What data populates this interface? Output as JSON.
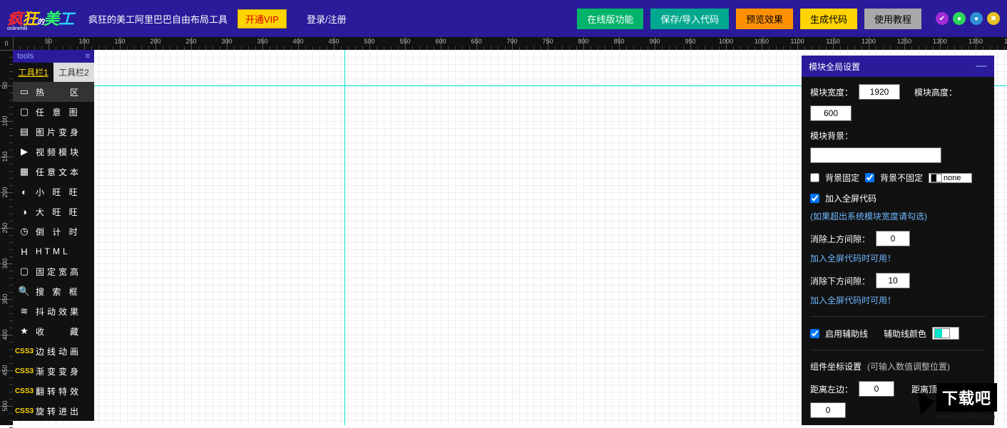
{
  "header": {
    "app_title": "疯狂的美工阿里巴巴自由布局工具",
    "vip": "开通VIP",
    "auth": "登录/注册",
    "buttons": {
      "online": "在线版功能",
      "saveload": "保存/导入代码",
      "preview": "预览效果",
      "generate": "生成代码",
      "tutorial": "使用教程"
    },
    "circles": {
      "a": "✔",
      "b": "●",
      "c": "●",
      "d": "✖"
    }
  },
  "ruler": {
    "corner": "0"
  },
  "toolbox": {
    "title": "tools",
    "handle": "≡",
    "tabs": {
      "t1": "工具栏1",
      "t2": "工具栏2"
    },
    "items": [
      {
        "icon": "▭",
        "label": "热　　区"
      },
      {
        "icon": "▢",
        "label": "任 意 图"
      },
      {
        "icon": "▤",
        "label": "图片变身"
      },
      {
        "icon": "▶",
        "label": "视频模块"
      },
      {
        "icon": "▦",
        "label": "任意文本"
      },
      {
        "icon": "◐",
        "label": "小 旺 旺"
      },
      {
        "icon": "◑",
        "label": "大 旺 旺"
      },
      {
        "icon": "◷",
        "label": "倒 计 时"
      },
      {
        "icon": "H",
        "label": "HTML"
      },
      {
        "icon": "▢",
        "label": "固定宽高"
      },
      {
        "icon": "🔍",
        "label": "搜 索 框"
      },
      {
        "icon": "≋",
        "label": "抖动效果"
      },
      {
        "icon": "★",
        "label": "收　　藏"
      },
      {
        "icon": "CSS3",
        "label": "边线动画"
      },
      {
        "icon": "CSS3",
        "label": "渐变变身"
      },
      {
        "icon": "CSS3",
        "label": "翻转特效"
      },
      {
        "icon": "CSS3",
        "label": "旋转进出"
      }
    ]
  },
  "settings": {
    "title": "模块全局设置",
    "width_lbl": "模块宽度：",
    "width_val": "1920",
    "height_lbl": "模块高度：",
    "height_val": "600",
    "bg_lbl": "模块背景：",
    "bg_fixed": "背景固定",
    "bg_notfixed": "背景不固定",
    "bg_repeat_val": "none",
    "full_lbl": "加入全屏代码",
    "full_hint": "(如果超出系统模块宽度请勾选)",
    "gap_top_lbl": "消除上方间隙：",
    "gap_top_val": "0",
    "gap_note": "加入全屏代码时可用！",
    "gap_bot_lbl": "消除下方间隙：",
    "gap_bot_val": "10",
    "guides_lbl": "启用辅助线",
    "guides_color_lbl": "辅助线颜色",
    "coord_lbl": "组件坐标设置",
    "coord_hint": "(可输入数值调整位置)",
    "left_lbl": "距离左边：",
    "left_val": "0",
    "top_lbl": "距离顶边：",
    "top_val": "0"
  },
  "watermark": {
    "text": "下载吧",
    "sub": "www.xiazaiba.com"
  }
}
